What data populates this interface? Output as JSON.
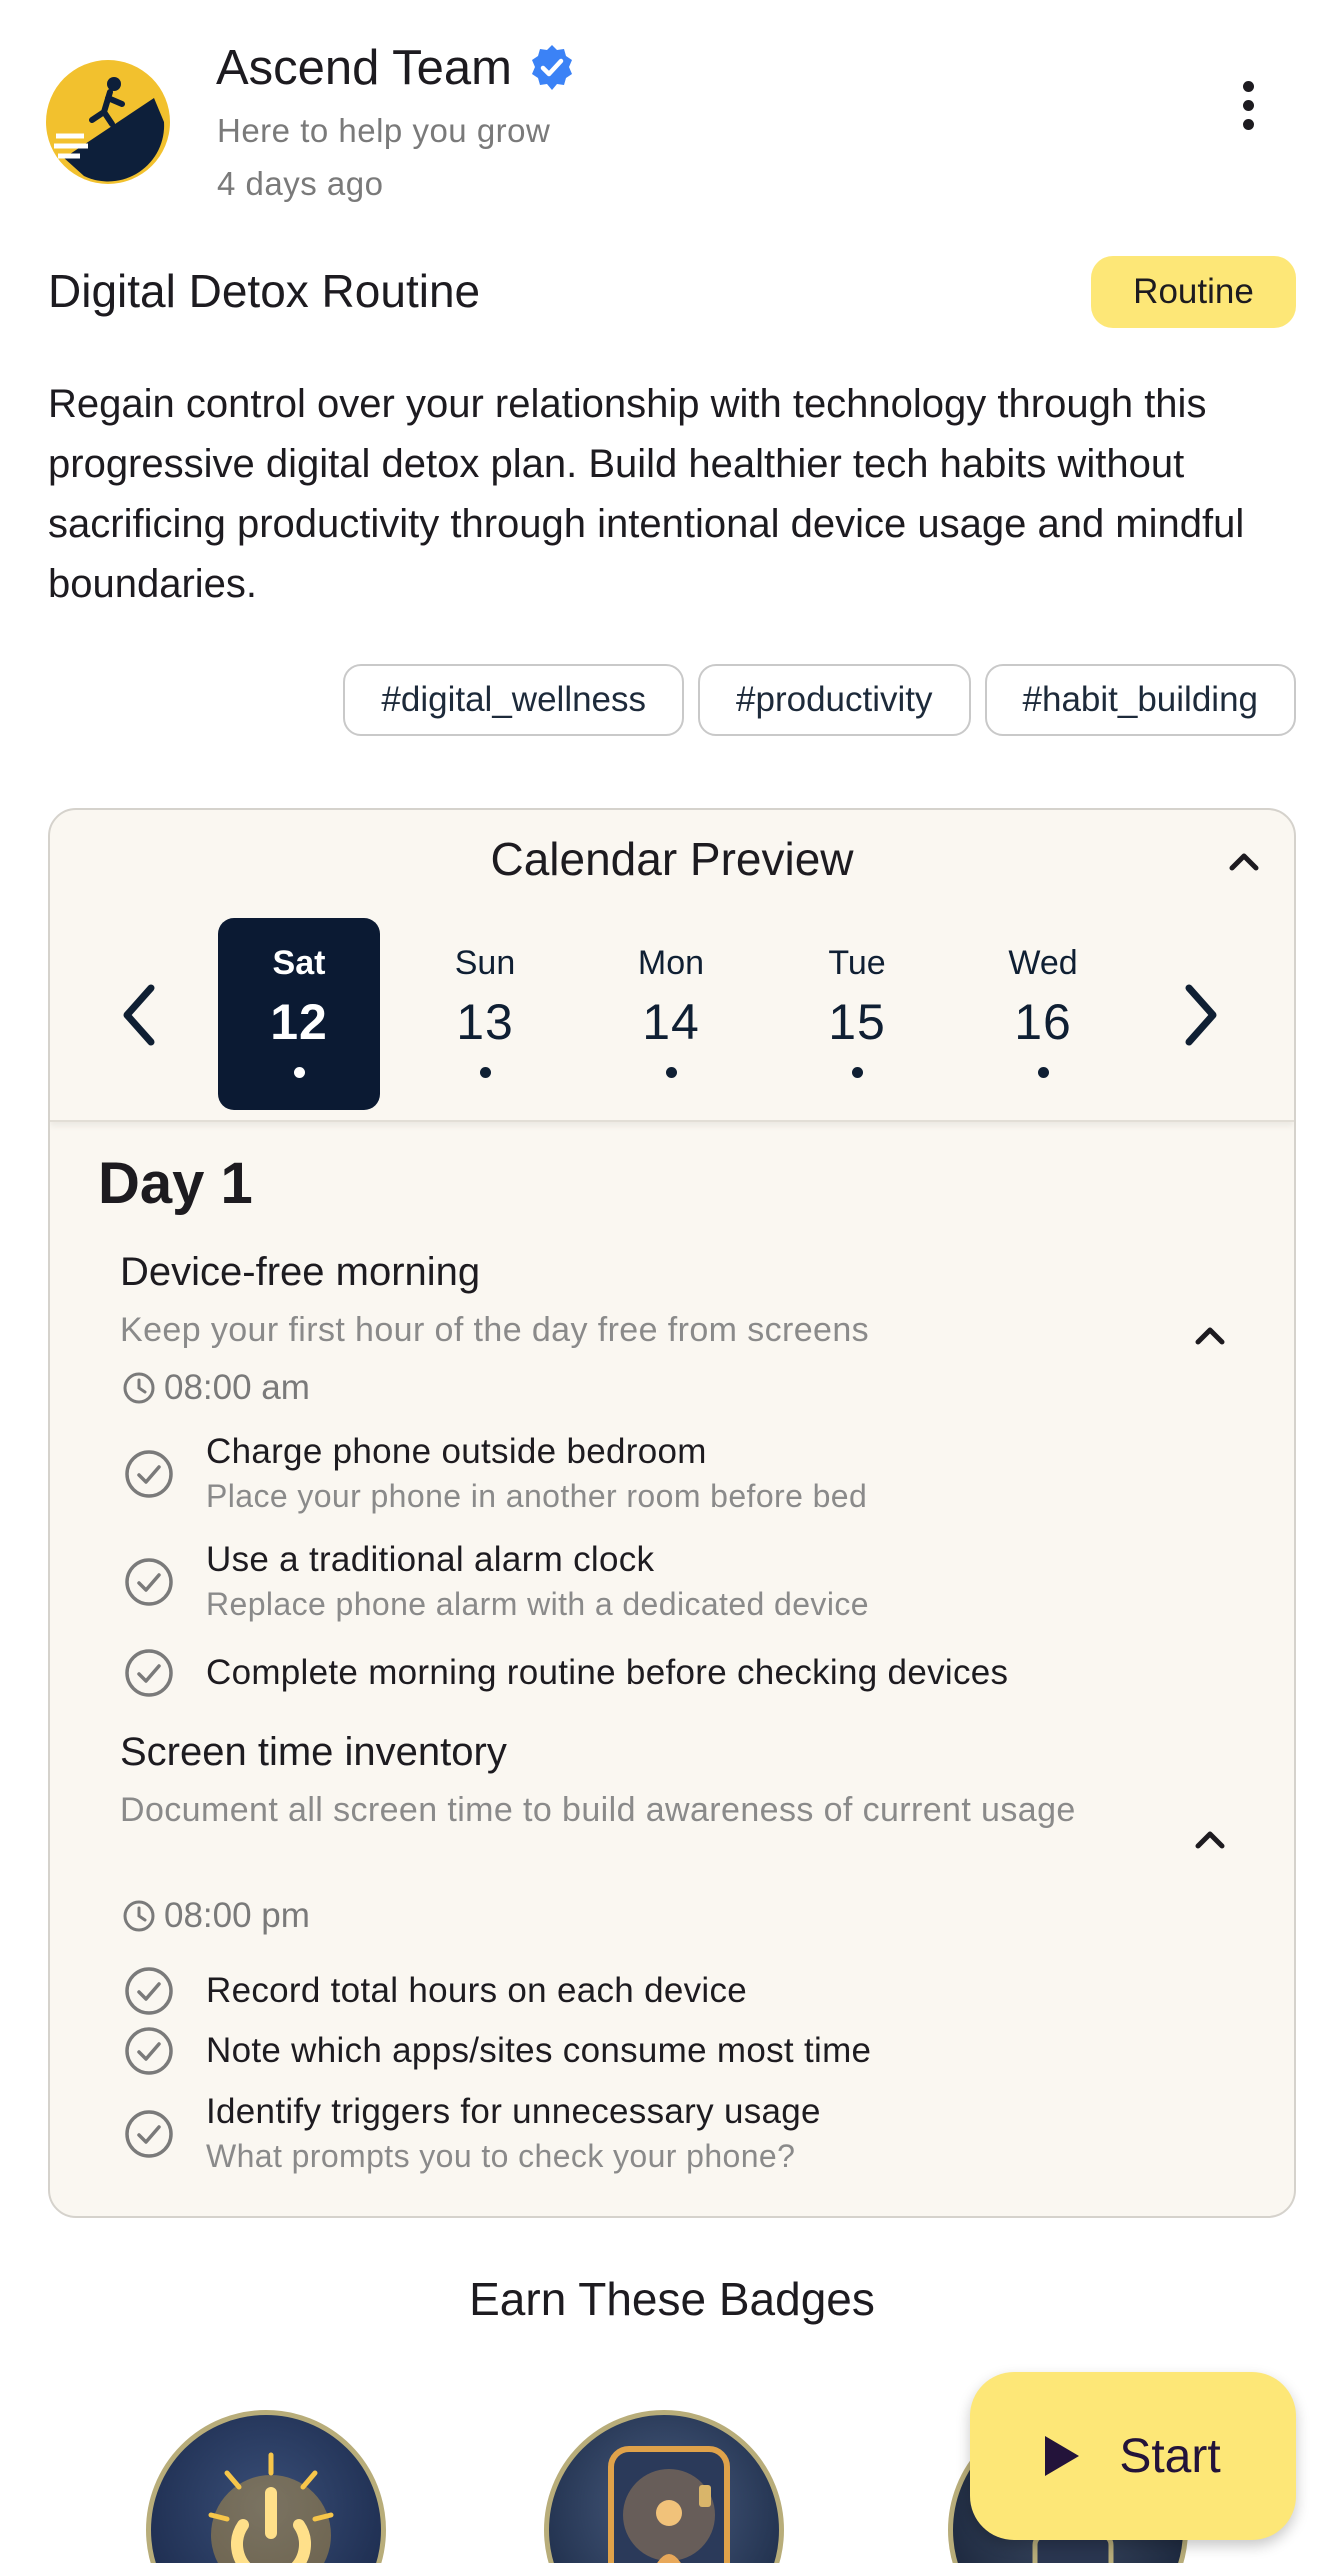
{
  "header": {
    "author_name": "Ascend Team",
    "author_tagline": "Here to help you grow",
    "posted_time": "4 days ago",
    "logo_icon": "mountain-climber-logo",
    "verified_icon": "verified-badge-icon",
    "more_icon": "more-vert-icon"
  },
  "post": {
    "title": "Digital Detox Routine",
    "type_label": "Routine",
    "description": "Regain control over your relationship with technology through this progressive digital detox plan. Build healthier tech habits without sacrificing productivity through intentional device usage and mindful boundaries.",
    "tags": [
      "#digital_wellness",
      "#productivity",
      "#habit_building"
    ]
  },
  "calendar": {
    "title": "Calendar Preview",
    "days": [
      {
        "name": "Sat",
        "num": "12",
        "selected": true
      },
      {
        "name": "Sun",
        "num": "13",
        "selected": false
      },
      {
        "name": "Mon",
        "num": "14",
        "selected": false
      },
      {
        "name": "Tue",
        "num": "15",
        "selected": false
      },
      {
        "name": "Wed",
        "num": "16",
        "selected": false
      }
    ],
    "day_title": "Day 1",
    "events": [
      {
        "title": "Device-free morning",
        "subtitle": "Keep your first hour of the day free from screens",
        "time": "08:00 am",
        "tasks": [
          {
            "label": "Charge phone outside bedroom",
            "sub": "Place your phone in another room before bed"
          },
          {
            "label": "Use a traditional alarm clock",
            "sub": "Replace phone alarm with a dedicated device"
          },
          {
            "label": "Complete morning routine before checking devices",
            "sub": ""
          }
        ]
      },
      {
        "title": "Screen time inventory",
        "subtitle": "Document all screen time to build awareness of current usage",
        "time": "08:00 pm",
        "tasks": [
          {
            "label": "Record total hours on each device",
            "sub": ""
          },
          {
            "label": "Note which apps/sites consume most time",
            "sub": ""
          },
          {
            "label": "Identify triggers for unnecessary usage",
            "sub": "What prompts you to check your phone?"
          }
        ]
      }
    ]
  },
  "badges": {
    "title": "Earn These Badges",
    "icons": [
      "power-glow-badge-icon",
      "meditating-figure-phone-badge-icon",
      "phone-frame-badge-icon"
    ]
  },
  "actions": {
    "start_label": "Start",
    "play_icon": "play-icon"
  },
  "colors": {
    "accent_yellow": "#fde777",
    "selected_day_bg": "#0b1a33",
    "verified_blue": "#3b82f6",
    "calendar_bg": "#faf7f1"
  }
}
